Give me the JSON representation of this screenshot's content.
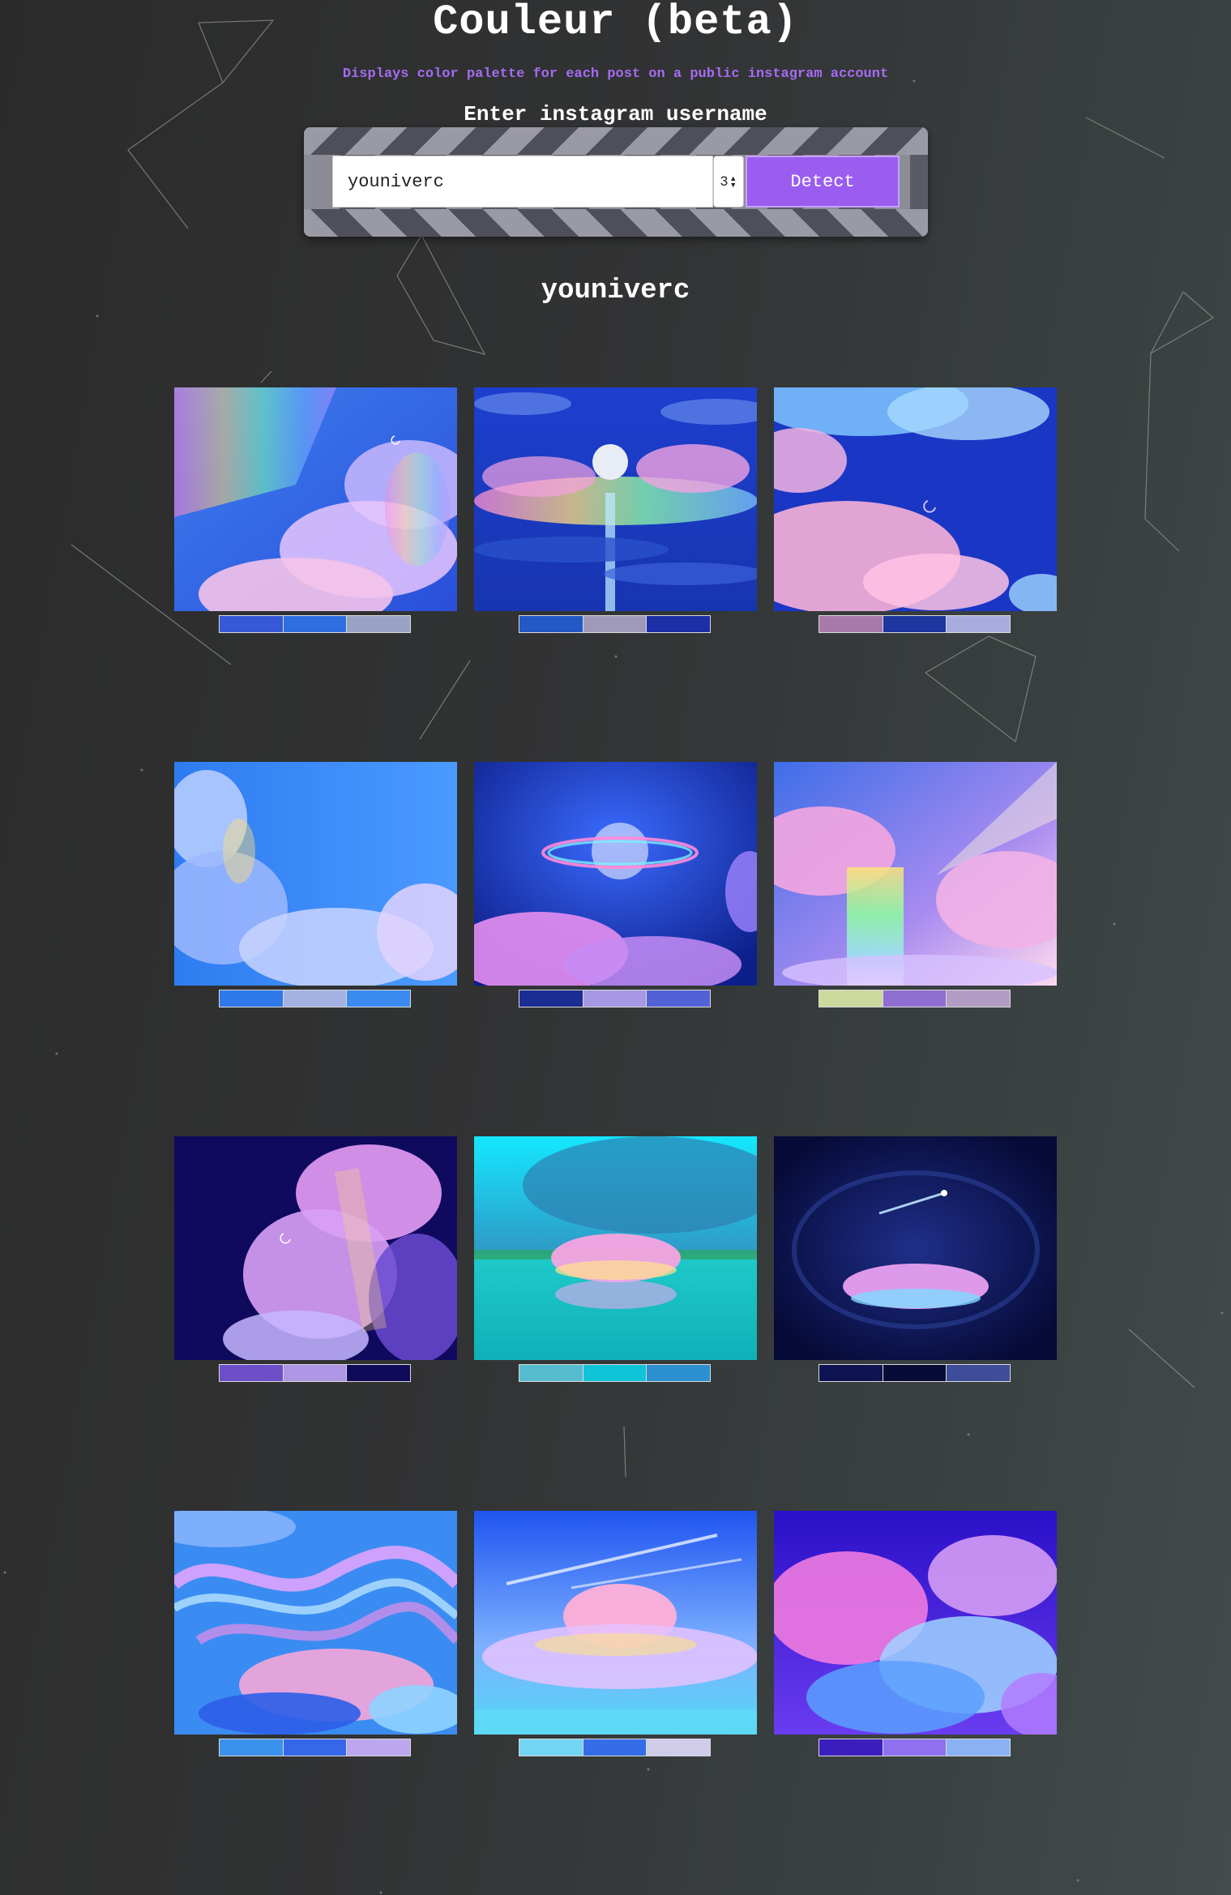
{
  "header": {
    "title": "Couleur (beta)",
    "subtitle": "Displays color palette for each post on a public instagram account",
    "enter_label": "Enter instagram username"
  },
  "form": {
    "username_value": "youniverc",
    "color_count": "3",
    "detect_label": "Detect"
  },
  "profile": {
    "username": "youniverc"
  },
  "posts": [
    {
      "scene": "sky with clouds and rainbow light rays",
      "palette": [
        "#3559d8",
        "#2e6fe0",
        "#9aa3c3"
      ]
    },
    {
      "scene": "moon over rainbow clouds with waterfall",
      "palette": [
        "#2458c6",
        "#a09aba",
        "#1c2fa6"
      ]
    },
    {
      "scene": "pink clouds with crescent moon",
      "palette": [
        "#a77aa9",
        "#1f35a0",
        "#a9acdf"
      ]
    },
    {
      "scene": "blue sky with rainbow-edged clouds",
      "palette": [
        "#2e78ea",
        "#a3b1e3",
        "#3a8af0"
      ]
    },
    {
      "scene": "ringed glowing planet above pink clouds",
      "palette": [
        "#1b2d92",
        "#a698e3",
        "#5262d6"
      ]
    },
    {
      "scene": "rainbow waterfall from pink clouds",
      "palette": [
        "#cdd89d",
        "#8f6ed1",
        "#b29cc4"
      ]
    },
    {
      "scene": "rainbow cloud at night with crescent moon",
      "palette": [
        "#6c4ec8",
        "#ad96e6",
        "#100a5a"
      ]
    },
    {
      "scene": "rainbow cloud over turquoise water",
      "palette": [
        "#55bcd0",
        "#0fc4d8",
        "#2a90d0"
      ]
    },
    {
      "scene": "rainbow cloud and comet in night sky",
      "palette": [
        "#0e1352",
        "#070b36",
        "#3d4d9a"
      ]
    },
    {
      "scene": "swirling marbled sky over rainbow clouds",
      "palette": [
        "#3a92ec",
        "#3667ea",
        "#bca7ee"
      ]
    },
    {
      "scene": "rainbow cumulus cloud over sea",
      "palette": [
        "#72d5f2",
        "#356de8",
        "#cfcbe8"
      ]
    },
    {
      "scene": "pink and blue clouds in purple night sky",
      "palette": [
        "#3b1fbe",
        "#8f70f0",
        "#89b1f4"
      ]
    }
  ]
}
